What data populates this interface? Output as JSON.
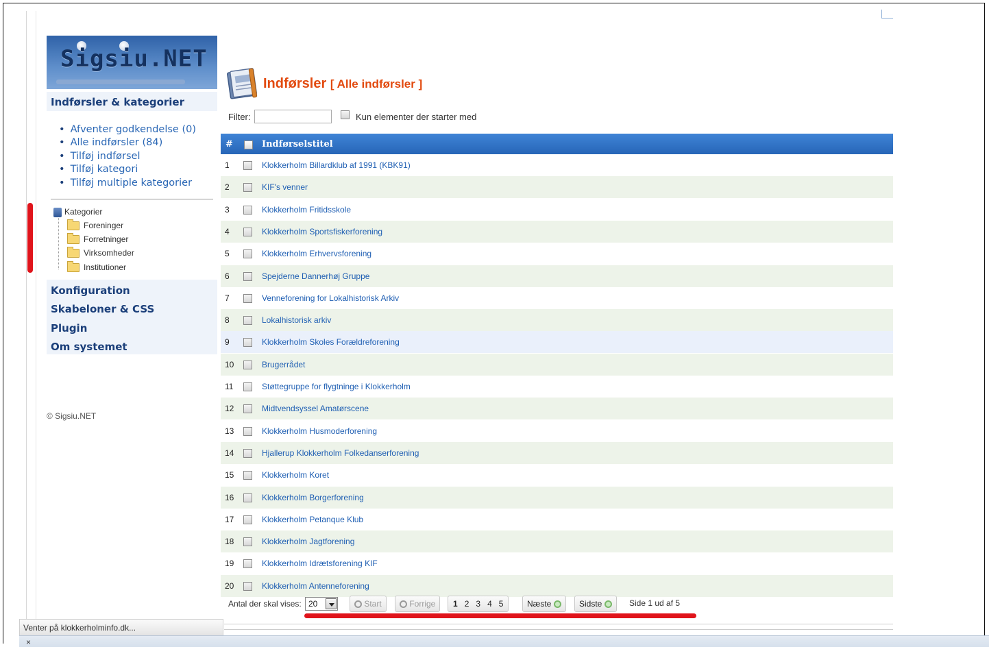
{
  "logo": {
    "text": "Sigsiu.NET"
  },
  "sidebar": {
    "section_title": "Indførsler & kategorier",
    "menu": [
      {
        "label": "Afventer godkendelse (0)"
      },
      {
        "label": "Alle indførsler (84)"
      },
      {
        "label": "Tilføj indførsel"
      },
      {
        "label": "Tilføj kategori"
      },
      {
        "label": "Tilføj multiple kategorier"
      }
    ],
    "tree": {
      "root": "Kategorier",
      "children": [
        "Foreninger",
        "Forretninger",
        "Virksomheder",
        "Institutioner"
      ]
    },
    "sections": [
      "Konfiguration",
      "Skabeloner & CSS",
      "Plugin",
      "Om systemet"
    ],
    "footer": "© Sigsiu.NET"
  },
  "main": {
    "title": "Indførsler",
    "subtitle": "[ Alle indførsler ]",
    "filter": {
      "label": "Filter:",
      "value": "",
      "checkbox_label": "Kun elementer der starter med"
    },
    "table": {
      "header_num": "#",
      "header_title": "Indførselstitel",
      "rows": [
        {
          "num": "1",
          "title": "Klokkerholm Billardklub af 1991 (KBK91)"
        },
        {
          "num": "2",
          "title": "KIF's venner"
        },
        {
          "num": "3",
          "title": "Klokkerholm Fritidsskole"
        },
        {
          "num": "4",
          "title": "Klokkerholm Sportsfiskerforening"
        },
        {
          "num": "5",
          "title": "Klokkerholm Erhvervsforening"
        },
        {
          "num": "6",
          "title": "Spejderne Dannerhøj Gruppe"
        },
        {
          "num": "7",
          "title": "Venneforening for Lokalhistorisk Arkiv"
        },
        {
          "num": "8",
          "title": "Lokalhistorisk arkiv"
        },
        {
          "num": "9",
          "title": "Klokkerholm Skoles Forældreforening"
        },
        {
          "num": "10",
          "title": "Brugerrådet"
        },
        {
          "num": "11",
          "title": "Støttegruppe for flygtninge i Klokkerholm"
        },
        {
          "num": "12",
          "title": "Midtvendsyssel Amatørscene"
        },
        {
          "num": "13",
          "title": "Klokkerholm Husmoderforening"
        },
        {
          "num": "14",
          "title": "Hjallerup Klokkerholm Folkedanserforening"
        },
        {
          "num": "15",
          "title": "Klokkerholm Koret"
        },
        {
          "num": "16",
          "title": "Klokkerholm Borgerforening"
        },
        {
          "num": "17",
          "title": "Klokkerholm Petanque Klub"
        },
        {
          "num": "18",
          "title": "Klokkerholm Jagtforening"
        },
        {
          "num": "19",
          "title": "Klokkerholm Idrætsforening KIF"
        },
        {
          "num": "20",
          "title": "Klokkerholm Antenneforening"
        }
      ]
    },
    "pager": {
      "per_page_label": "Antal der skal vises:",
      "per_page_value": "20",
      "start": "Start",
      "prev": "Forrige",
      "pages": [
        "1",
        "2",
        "3",
        "4",
        "5"
      ],
      "next": "Næste",
      "last": "Sidste",
      "info": "Side 1 ud af 5"
    }
  },
  "browser": {
    "status": "Venter på klokkerholminfo.dk...",
    "close": "×"
  },
  "colors": {
    "accent": "#2766b8",
    "title": "#e24a0f",
    "link": "#1f5fb3",
    "annotation": "#e0141b"
  }
}
